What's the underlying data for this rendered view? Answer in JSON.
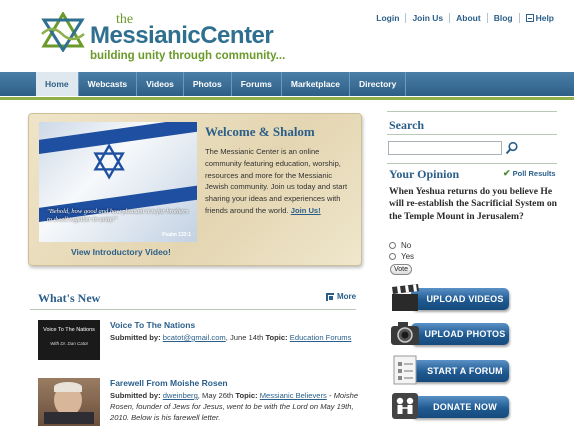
{
  "header": {
    "logo_the": "the",
    "logo_name": "MessianicCenter",
    "logo_tagline": "building unity through community..."
  },
  "top_links": [
    "Login",
    "Join Us",
    "About",
    "Blog",
    "Help"
  ],
  "nav": [
    "Home",
    "Webcasts",
    "Videos",
    "Photos",
    "Forums",
    "Marketplace",
    "Directory"
  ],
  "welcome": {
    "title": "Welcome & Shalom",
    "body": "The Messianic Center is an online community featuring education, worship, resources and more for the Messianic Jewish community. Join us today and start sharing your ideas and experiences with friends around the world.",
    "join_link": "Join Us!",
    "image_quote": "\"Behold, how good and how pleasant it is for brothers to dwell together in unity!\"",
    "image_citation": "Psalm 133:1",
    "video_link": "View Introductory Video!"
  },
  "whats_new": {
    "title": "What's New",
    "more_label": "More",
    "items": [
      {
        "title": "Voice To The Nations",
        "submitted_label": "Submitted by:",
        "author": "bcatot@gmail.com",
        "date": ", June 14th",
        "topic_label": "Topic:",
        "topic": "Education Forums",
        "thumb_line1": "Voice To The Nations",
        "thumb_line2": "With Dr. Dan Catot"
      },
      {
        "title": "Farewell From Moishe Rosen",
        "submitted_label": "Submitted by:",
        "author": "dweinberg",
        "date": ", May 26th",
        "topic_label": "Topic:",
        "topic": "Messianic Believers",
        "excerpt": " - Moishe Rosen, founder of Jews for Jesus, went to be with the Lord on May 19th, 2010.  Below is his farewell letter."
      }
    ]
  },
  "sidebar": {
    "search_title": "Search",
    "search_value": "",
    "opinion_title": "Your Opinion",
    "poll_results": "Poll Results",
    "question": "When Yeshua returns do you believe He will re-establish the Sacrificial System on the Temple Mount in Jerusalem?",
    "options": [
      "No",
      "Yes"
    ],
    "vote_label": "Vote",
    "buttons": [
      "UPLOAD VIDEOS",
      "UPLOAD PHOTOS",
      "START A FORUM",
      "DONATE NOW"
    ]
  }
}
